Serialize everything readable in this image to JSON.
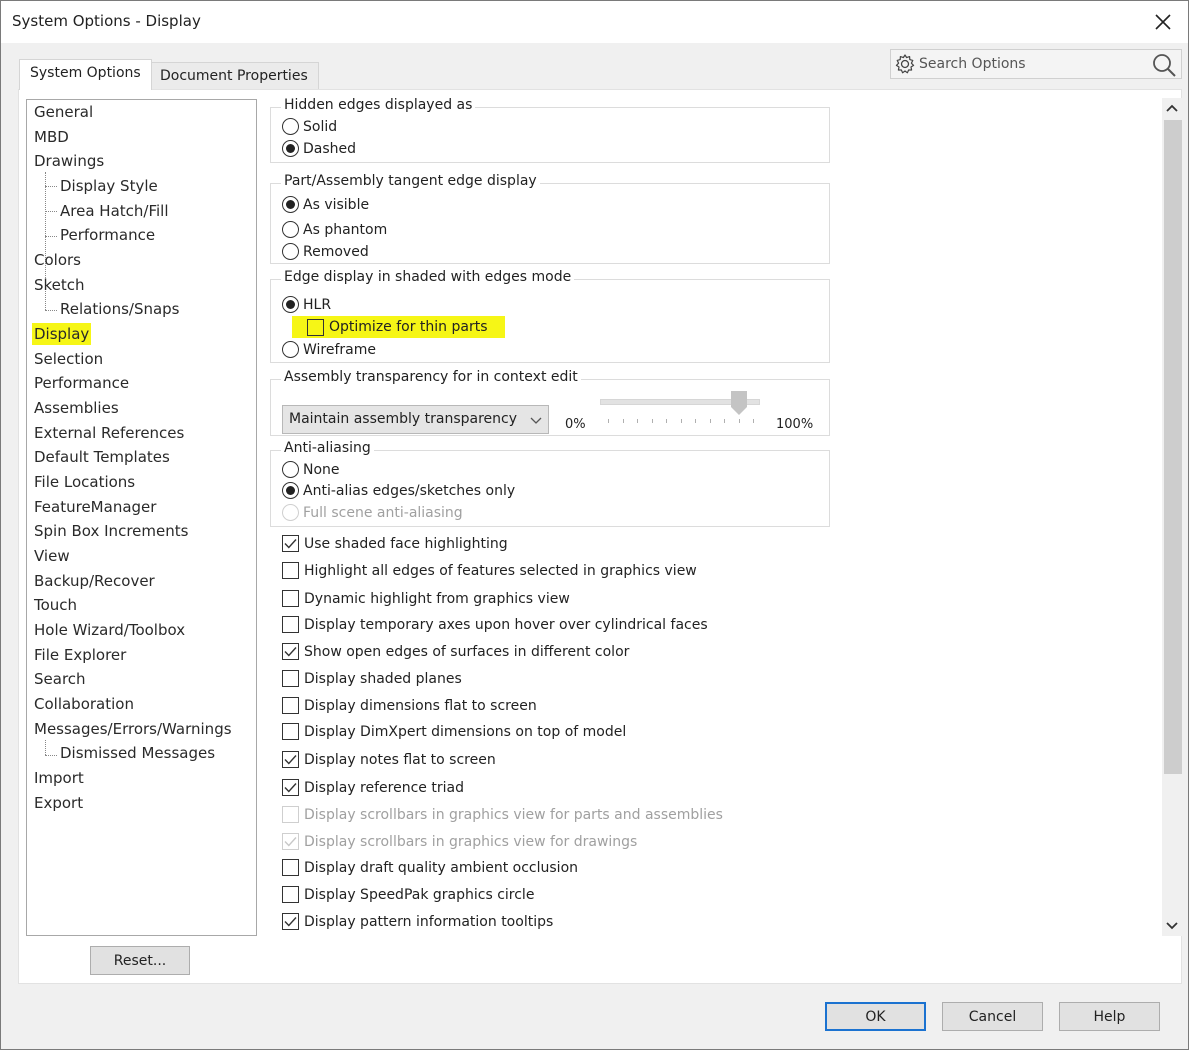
{
  "window": {
    "title": "System Options - Display",
    "close_icon": "close-x-icon"
  },
  "tabs": [
    {
      "label": "System Options",
      "active": true
    },
    {
      "label": "Document Properties",
      "active": false
    }
  ],
  "search": {
    "placeholder": "Search Options",
    "value": "",
    "left_icon": "gear-icon",
    "right_icon": "search-icon"
  },
  "tree": {
    "items": [
      {
        "label": "General",
        "level": 0
      },
      {
        "label": "MBD",
        "level": 0
      },
      {
        "label": "Drawings",
        "level": 0
      },
      {
        "label": "Display Style",
        "level": 1
      },
      {
        "label": "Area Hatch/Fill",
        "level": 1
      },
      {
        "label": "Performance",
        "level": 1
      },
      {
        "label": "Colors",
        "level": 0
      },
      {
        "label": "Sketch",
        "level": 0
      },
      {
        "label": "Relations/Snaps",
        "level": 1
      },
      {
        "label": "Display",
        "level": 0,
        "selected": true
      },
      {
        "label": "Selection",
        "level": 0
      },
      {
        "label": "Performance",
        "level": 0
      },
      {
        "label": "Assemblies",
        "level": 0
      },
      {
        "label": "External References",
        "level": 0
      },
      {
        "label": "Default Templates",
        "level": 0
      },
      {
        "label": "File Locations",
        "level": 0
      },
      {
        "label": "FeatureManager",
        "level": 0
      },
      {
        "label": "Spin Box Increments",
        "level": 0
      },
      {
        "label": "View",
        "level": 0
      },
      {
        "label": "Backup/Recover",
        "level": 0
      },
      {
        "label": "Touch",
        "level": 0
      },
      {
        "label": "Hole Wizard/Toolbox",
        "level": 0
      },
      {
        "label": "File Explorer",
        "level": 0
      },
      {
        "label": "Search",
        "level": 0
      },
      {
        "label": "Collaboration",
        "level": 0
      },
      {
        "label": "Messages/Errors/Warnings",
        "level": 0
      },
      {
        "label": "Dismissed Messages",
        "level": 1
      },
      {
        "label": "Import",
        "level": 0
      },
      {
        "label": "Export",
        "level": 0
      }
    ],
    "reset_label": "Reset..."
  },
  "groups": {
    "hidden_edges": {
      "label": "Hidden edges displayed as",
      "options": [
        "Solid",
        "Dashed"
      ],
      "selected": "Dashed"
    },
    "tangent_edge": {
      "label": "Part/Assembly tangent edge display",
      "options": [
        "As visible",
        "As phantom",
        "Removed"
      ],
      "selected": "As visible"
    },
    "edge_display": {
      "label": "Edge display in shaded with edges mode",
      "options": [
        "HLR",
        "Wireframe"
      ],
      "selected": "HLR",
      "sub_option": {
        "label": "Optimize for thin parts",
        "checked": false,
        "highlighted": true
      }
    },
    "assembly_transparency": {
      "label": "Assembly transparency for in context edit",
      "dropdown_value": "Maintain assembly transparency",
      "slider_min_label": "0%",
      "slider_max_label": "100%",
      "slider_value_percent": 90
    },
    "anti_aliasing": {
      "label": "Anti-aliasing",
      "options": [
        "None",
        "Anti-alias edges/sketches only",
        "Full scene anti-aliasing"
      ],
      "selected": "Anti-alias edges/sketches only",
      "disabled": [
        "Full scene anti-aliasing"
      ]
    }
  },
  "checkboxes": [
    {
      "label": "Use shaded face highlighting",
      "checked": true,
      "disabled": false
    },
    {
      "label": "Highlight all edges of features selected in graphics view",
      "checked": false,
      "disabled": false
    },
    {
      "label": "Dynamic highlight from graphics view",
      "checked": false,
      "disabled": false
    },
    {
      "label": "Display temporary axes upon hover over cylindrical faces",
      "checked": false,
      "disabled": false
    },
    {
      "label": "Show open edges of surfaces in different color",
      "checked": true,
      "disabled": false
    },
    {
      "label": "Display shaded planes",
      "checked": false,
      "disabled": false
    },
    {
      "label": "Display dimensions flat to screen",
      "checked": false,
      "disabled": false
    },
    {
      "label": "Display DimXpert dimensions on top of model",
      "checked": false,
      "disabled": false
    },
    {
      "label": "Display notes flat to screen",
      "checked": true,
      "disabled": false
    },
    {
      "label": "Display reference triad",
      "checked": true,
      "disabled": false
    },
    {
      "label": "Display scrollbars in graphics view for parts and assemblies",
      "checked": false,
      "disabled": true
    },
    {
      "label": "Display scrollbars in graphics view for drawings",
      "checked": true,
      "disabled": true
    },
    {
      "label": "Display draft quality ambient occlusion",
      "checked": false,
      "disabled": false
    },
    {
      "label": "Display SpeedPak graphics circle",
      "checked": false,
      "disabled": false
    },
    {
      "label": "Display pattern information tooltips",
      "checked": true,
      "disabled": false
    }
  ],
  "buttons": {
    "ok": "OK",
    "cancel": "Cancel",
    "help": "Help"
  },
  "colors": {
    "highlight": "#f6f616",
    "primary_button_border": "#1b72d0"
  }
}
